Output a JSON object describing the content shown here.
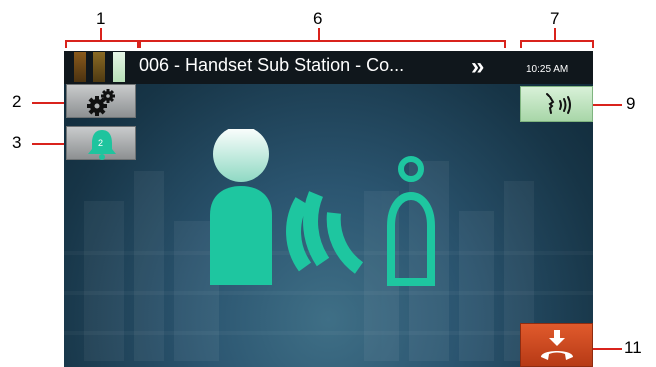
{
  "callouts": {
    "c1": "1",
    "c2": "2",
    "c3": "3",
    "c6": "6",
    "c7": "7",
    "c9": "9",
    "c11": "11"
  },
  "status_bar": {
    "station_title": "006 - Handset Sub Station - Co...",
    "time": "10:25 AM",
    "forward_icon": "double-chevron-right-icon",
    "signal_icon": "signal-level-icon"
  },
  "sidebar": {
    "settings_icon": "gears-icon",
    "notifications_icon": "bell-icon",
    "notifications_count": "2"
  },
  "actions": {
    "talk_icon": "speaking-person-icon",
    "end_call_icon": "hang-up-icon"
  },
  "illustration": {
    "icon": "person-calling-handset-icon"
  },
  "colors": {
    "callout_red": "#d9231c",
    "accent_teal": "#1ec6a0",
    "talk_green": "#b4dfb4",
    "end_call_red": "#d34a20",
    "top_bar": "#10171c"
  }
}
